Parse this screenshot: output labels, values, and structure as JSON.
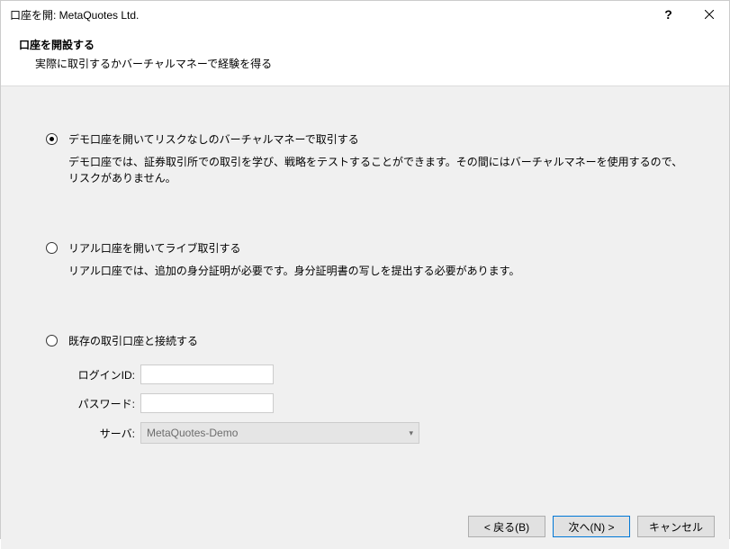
{
  "window": {
    "title": "口座を開: MetaQuotes Ltd."
  },
  "header": {
    "title": "口座を開設する",
    "subtitle": "実際に取引するかバーチャルマネーで経験を得る"
  },
  "options": {
    "demo": {
      "label": "デモ口座を開いてリスクなしのバーチャルマネーで取引する",
      "desc": "デモ口座では、証券取引所での取引を学び、戦略をテストすることができます。その間にはバーチャルマネーを使用するので、リスクがありません。"
    },
    "real": {
      "label": "リアル口座を開いてライブ取引する",
      "desc": "リアル口座では、追加の身分証明が必要です。身分証明書の写しを提出する必要があります。"
    },
    "existing": {
      "label": "既存の取引口座と接続する",
      "login_label": "ログインID:",
      "password_label": "パスワード:",
      "server_label": "サーバ:",
      "login_value": "",
      "password_value": "",
      "server_value": "MetaQuotes-Demo"
    }
  },
  "buttons": {
    "back": "< 戻る(B)",
    "next": "次へ(N) >",
    "cancel": "キャンセル"
  }
}
